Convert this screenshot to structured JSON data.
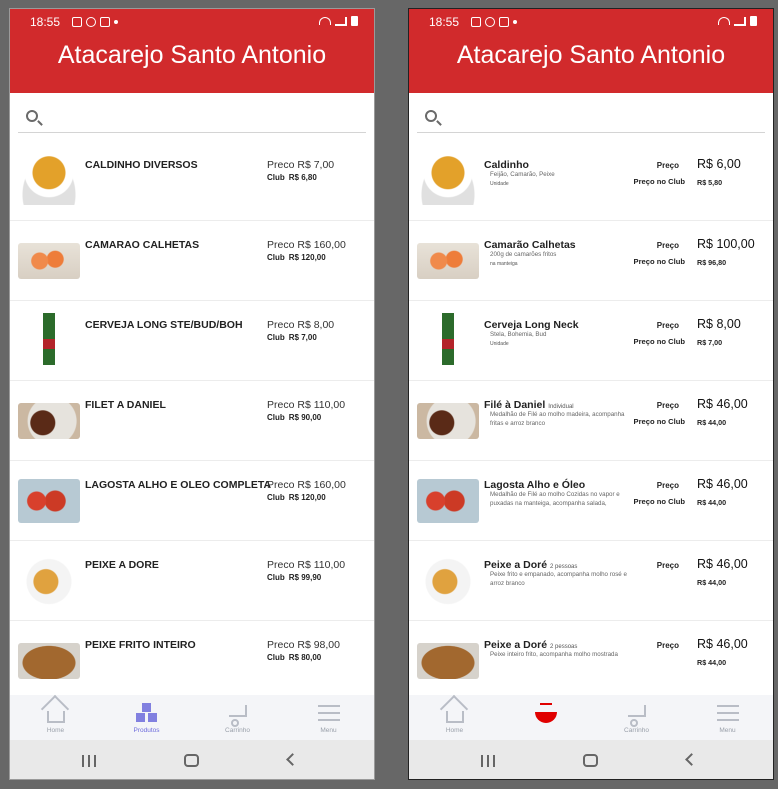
{
  "left_screen": {
    "status_time": "18:55",
    "title": "Atacarejo Santo Antonio",
    "items": [
      {
        "name": "CALDINHO DIVERSOS",
        "price_label": "Preco",
        "price": "R$ 7,00",
        "club_label": "Club",
        "club_price": "R$ 6,80"
      },
      {
        "name": "CAMARAO CALHETAS",
        "price_label": "Preco",
        "price": "R$ 160,00",
        "club_label": "Club",
        "club_price": "R$ 120,00"
      },
      {
        "name": "CERVEJA LONG STE/BUD/BOH",
        "price_label": "Preco",
        "price": "R$ 8,00",
        "club_label": "Club",
        "club_price": "R$ 7,00"
      },
      {
        "name": "FILET A DANIEL",
        "price_label": "Preco",
        "price": "R$ 110,00",
        "club_label": "Club",
        "club_price": "R$ 90,00"
      },
      {
        "name": "LAGOSTA ALHO E OLEO COMPLETA",
        "price_label": "Preco",
        "price": "R$ 160,00",
        "club_label": "Club",
        "club_price": "R$ 120,00"
      },
      {
        "name": "PEIXE A DORE",
        "price_label": "Preco",
        "price": "R$ 110,00",
        "club_label": "Club",
        "club_price": "R$ 99,90"
      },
      {
        "name": "PEIXE FRITO INTEIRO",
        "price_label": "Preco",
        "price": "R$ 98,00",
        "club_label": "Club",
        "club_price": "R$ 80,00"
      }
    ],
    "tabs": [
      "Home",
      "Produtos",
      "Carrinho",
      "Menu"
    ]
  },
  "right_screen": {
    "status_time": "18:55",
    "title": "Atacarejo Santo Antonio",
    "price_label": "Preço",
    "club_label": "Preço no Club",
    "items": [
      {
        "name": "Caldinho",
        "tag": "",
        "desc": "Feijão, Camarão, Peixe",
        "sub": "Unidade",
        "price": "R$ 6,00",
        "club_price": "R$ 5,80"
      },
      {
        "name": "Camarão Calhetas",
        "tag": "",
        "desc": "200g de camarões fritos",
        "sub": "na manteiga",
        "price": "R$ 100,00",
        "club_price": "R$ 96,80"
      },
      {
        "name": "Cerveja Long Neck",
        "tag": "",
        "desc": "Stela, Bohemia, Bud",
        "sub": "Unidade",
        "price": "R$ 8,00",
        "club_price": "R$ 7,00"
      },
      {
        "name": "Filé à Daniel",
        "tag": "Individual",
        "desc": "Medalhão de Filé ao molho madeira, acompanha fritas e arroz branco",
        "sub": "",
        "price": "R$ 46,00",
        "club_price": "R$ 44,00"
      },
      {
        "name": "Lagosta Alho e Óleo",
        "tag": "",
        "desc": "Medalhão de Filé ao molho Cozidas no vapor e puxadas na manteiga, acompanha salada,",
        "sub": "",
        "price": "R$ 46,00",
        "club_price": "R$ 44,00"
      },
      {
        "name": "Peixe a Doré",
        "tag": "2 pessoas",
        "desc": "Peixe frito e empanado, acompanha molho rosé e arroz branco",
        "sub": "",
        "price": "R$ 46,00",
        "club_price": "R$ 44,00"
      },
      {
        "name": "Peixe a Doré",
        "tag": "2 pessoas",
        "desc": "Peixe inteiro frito, acompanha molho mostrada",
        "sub": "",
        "price": "R$ 46,00",
        "club_price": "R$ 44,00"
      }
    ],
    "tabs": [
      "Home",
      "",
      "Carrinho",
      "Menu"
    ]
  },
  "icons": {
    "search": "search-icon",
    "home": "home-icon",
    "products": "boxes-icon",
    "food": "bowl-icon",
    "cart": "cart-icon",
    "menu": "hamburger-menu-icon"
  },
  "colors": {
    "header": "#d12a2c",
    "active_tab": "#6e6cdc",
    "food_icon": "#e00000"
  }
}
